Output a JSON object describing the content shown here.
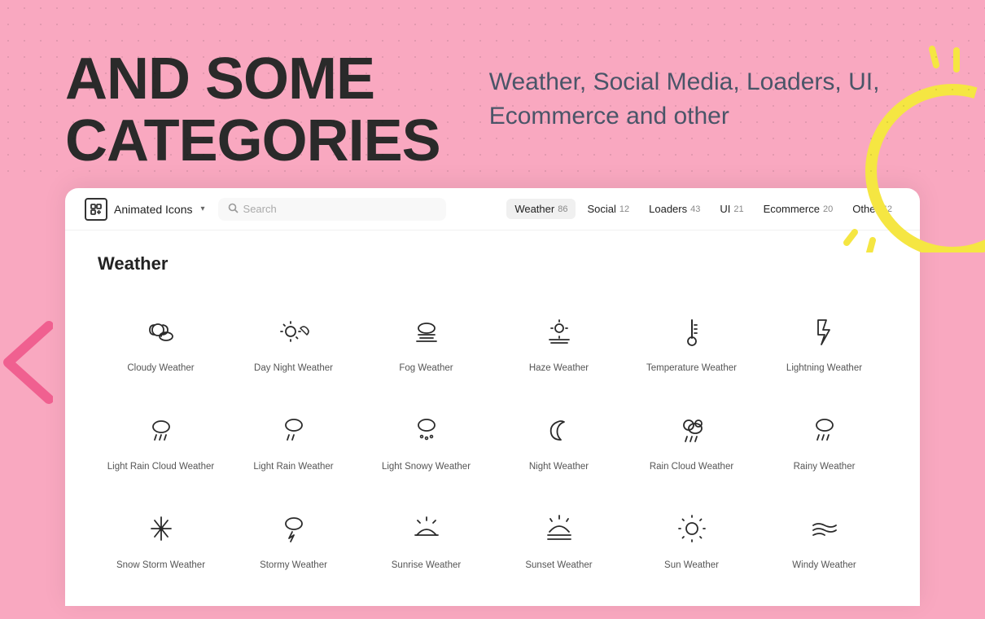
{
  "hero": {
    "heading_line1": "AND SOME",
    "heading_line2": "CATEGORIES",
    "description": "Weather, Social Media, Loaders, UI, Ecommerce and other"
  },
  "navbar": {
    "brand_label": "Animated Icons",
    "search_placeholder": "Search",
    "tabs": [
      {
        "label": "Weather",
        "count": "86",
        "active": true
      },
      {
        "label": "Social",
        "count": "12",
        "active": false
      },
      {
        "label": "Loaders",
        "count": "43",
        "active": false
      },
      {
        "label": "UI",
        "count": "21",
        "active": false
      },
      {
        "label": "Ecommerce",
        "count": "20",
        "active": false
      },
      {
        "label": "Other",
        "count": "42",
        "active": false
      }
    ]
  },
  "section": {
    "title": "Weather",
    "icons": [
      {
        "label": "Cloudy Weather"
      },
      {
        "label": "Day Night Weather"
      },
      {
        "label": "Fog Weather"
      },
      {
        "label": "Haze Weather"
      },
      {
        "label": "Temperature Weather"
      },
      {
        "label": "Lightning Weather"
      },
      {
        "label": "Light Rain Cloud Weather"
      },
      {
        "label": "Light Rain Weather"
      },
      {
        "label": "Light Snowy Weather"
      },
      {
        "label": "Night Weather"
      },
      {
        "label": "Rain Cloud Weather"
      },
      {
        "label": "Rainy Weather"
      },
      {
        "label": "Snow Storm Weather"
      },
      {
        "label": "Stormy Weather"
      },
      {
        "label": "Sunrise Weather"
      },
      {
        "label": "Sunset Weather"
      },
      {
        "label": "Sun Weather"
      },
      {
        "label": "Windy Weather"
      }
    ]
  }
}
